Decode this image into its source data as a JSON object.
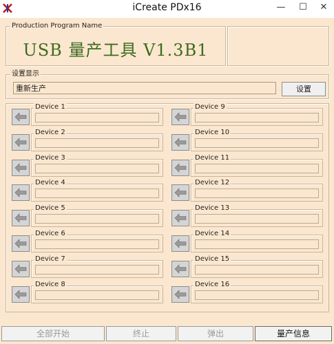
{
  "window": {
    "title": "iCreate PDx16",
    "minimize": "—",
    "maximize": "☐",
    "close": "✕"
  },
  "production": {
    "legend": "Production Program Name",
    "title": "USB 量产工具 V1.3B1"
  },
  "settings": {
    "legend": "设置显示",
    "value": "重新生产",
    "button": "设置"
  },
  "devices": [
    {
      "label": "Device 1"
    },
    {
      "label": "Device 2"
    },
    {
      "label": "Device 3"
    },
    {
      "label": "Device 4"
    },
    {
      "label": "Device 5"
    },
    {
      "label": "Device 6"
    },
    {
      "label": "Device 7"
    },
    {
      "label": "Device 8"
    },
    {
      "label": "Device 9"
    },
    {
      "label": "Device 10"
    },
    {
      "label": "Device 11"
    },
    {
      "label": "Device 12"
    },
    {
      "label": "Device 13"
    },
    {
      "label": "Device 14"
    },
    {
      "label": "Device 15"
    },
    {
      "label": "Device 16"
    }
  ],
  "bottom": {
    "start_all": "全部开始",
    "stop": "终止",
    "eject": "弹出",
    "info": "量产信息"
  }
}
